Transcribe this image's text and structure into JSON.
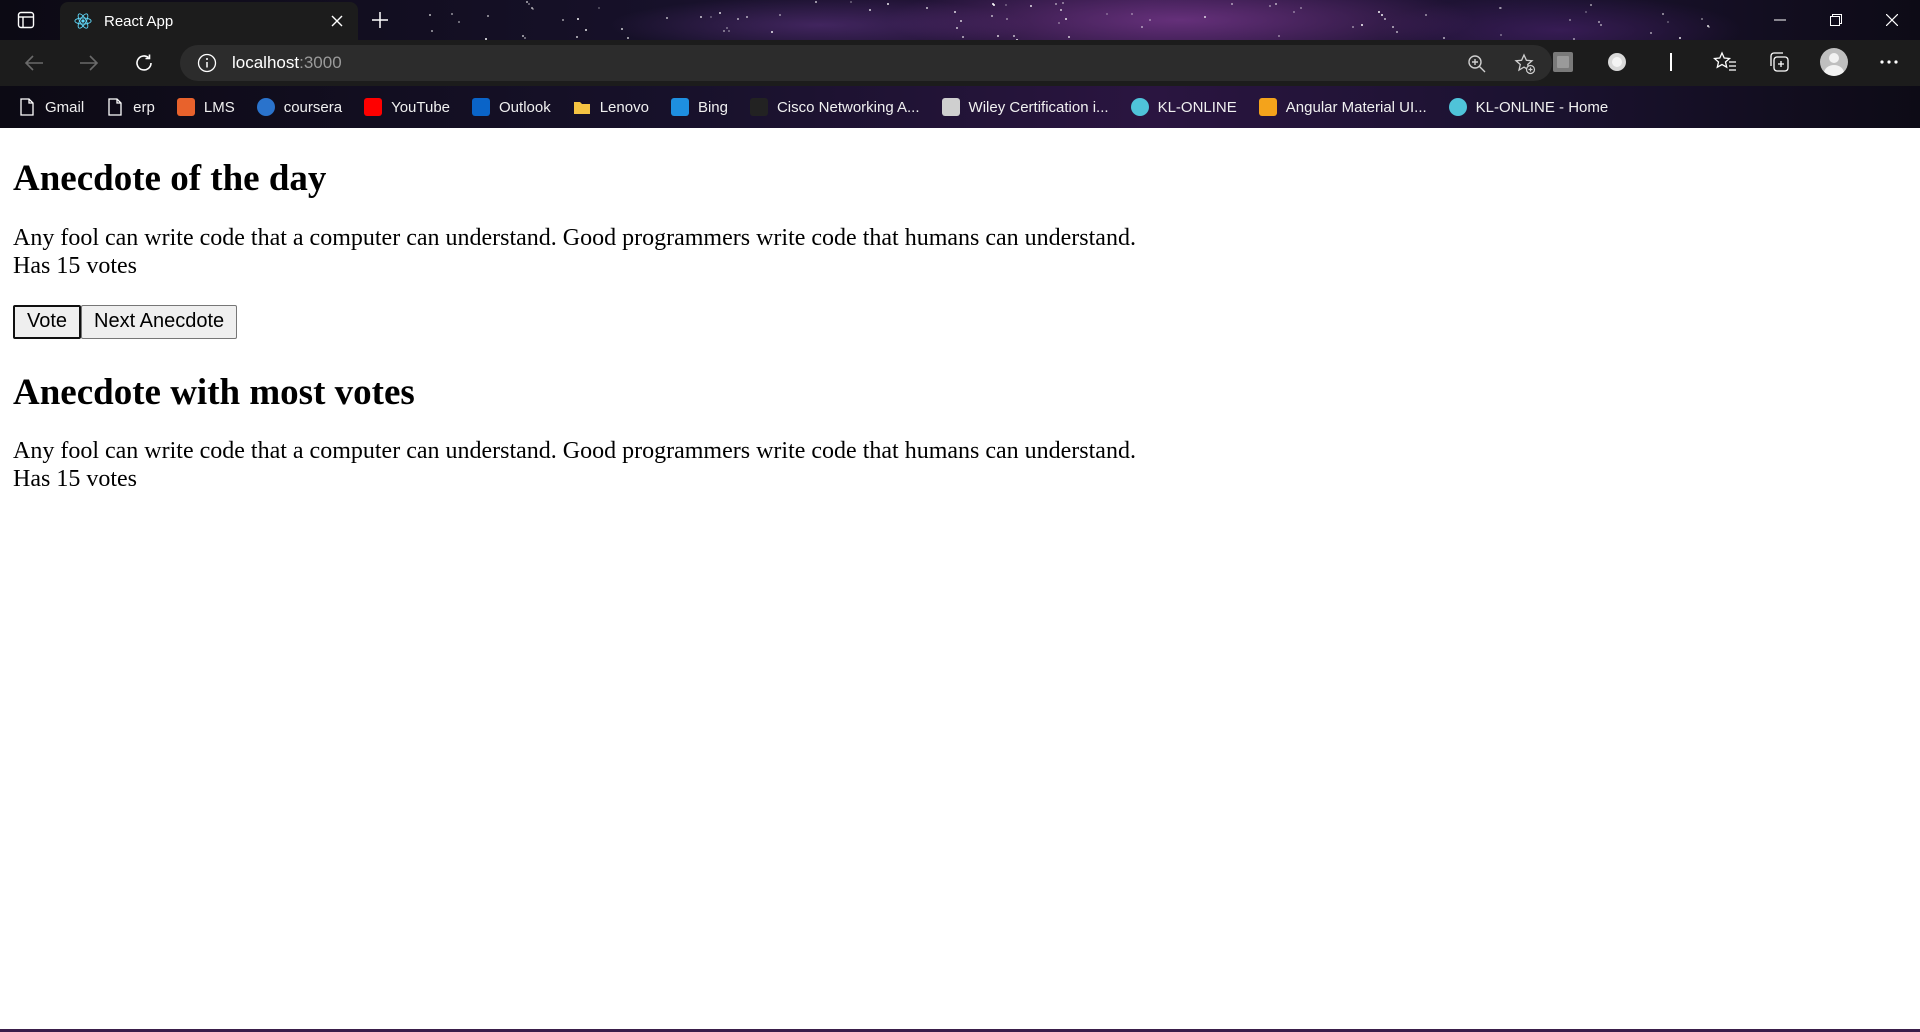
{
  "browser": {
    "tab": {
      "title": "React App"
    },
    "address": {
      "host": "localhost",
      "port": ":3000"
    },
    "bookmarks": [
      {
        "label": "Gmail",
        "icon": "page-icon",
        "color": "#ffffff"
      },
      {
        "label": "erp",
        "icon": "page-icon",
        "color": "#ffffff"
      },
      {
        "label": "LMS",
        "icon": "lms-icon",
        "color": "#e8622c"
      },
      {
        "label": "coursera",
        "icon": "coursera-icon",
        "color": "#2a73cc"
      },
      {
        "label": "YouTube",
        "icon": "youtube-icon",
        "color": "#ff0000"
      },
      {
        "label": "Outlook",
        "icon": "outlook-icon",
        "color": "#0a64c8"
      },
      {
        "label": "Lenovo",
        "icon": "folder-icon",
        "color": "#f5c342"
      },
      {
        "label": "Bing",
        "icon": "bing-icon",
        "color": "#1e8fe0"
      },
      {
        "label": "Cisco Networking A...",
        "icon": "cisco-icon",
        "color": "#222222"
      },
      {
        "label": "Wiley Certification i...",
        "icon": "wiley-icon",
        "color": "#cfcfcf"
      },
      {
        "label": "KL-ONLINE",
        "icon": "kl-online-icon",
        "color": "#4fc3d9"
      },
      {
        "label": "Angular Material UI...",
        "icon": "angular-material-icon",
        "color": "#f4a31b"
      },
      {
        "label": "KL-ONLINE - Home",
        "icon": "kl-online-icon",
        "color": "#4fc3d9"
      }
    ]
  },
  "page": {
    "section1": {
      "heading": "Anecdote of the day",
      "anecdote": "Any fool can write code that a computer can understand. Good programmers write code that humans can understand.",
      "votes": "Has 15 votes"
    },
    "buttons": {
      "vote": "Vote",
      "next": "Next Anecdote"
    },
    "section2": {
      "heading": "Anecdote with most votes",
      "anecdote": "Any fool can write code that a computer can understand. Good programmers write code that humans can understand.",
      "votes": "Has 15 votes"
    }
  }
}
